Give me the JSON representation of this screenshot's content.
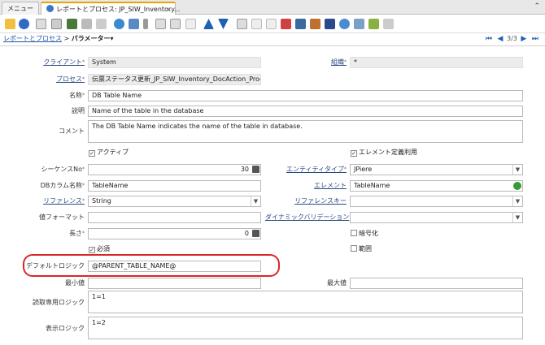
{
  "tabs": {
    "menu": "メニュー",
    "active": "レポートとプロセス: JP_SIW_Inventory...",
    "close": "×",
    "collapse": "⌃"
  },
  "breadcrumb": {
    "parent": "レポートとプロセス",
    "sep": ">",
    "current": "パラメーター▾"
  },
  "nav": {
    "record": "3/3"
  },
  "form": {
    "client_label": "クライアント",
    "client_value": "System",
    "org_label": "組織",
    "org_value": "*",
    "process_label": "プロセス",
    "process_value": "伝票ステータス更新_JP_SIW_Inventory_DocAction_Process",
    "name_label": "名称",
    "name_value": "DB Table Name",
    "desc_label": "説明",
    "desc_value": "Name of the table in the database",
    "comment_label": "コメント",
    "comment_value": "The DB Table Name indicates the name of the table in database.",
    "active_label": "アクティブ",
    "elem_def_label": "エレメント定義利用",
    "seq_label": "シーケンスNo",
    "seq_value": "30",
    "entity_label": "エンティティタイプ",
    "entity_value": "JPiere",
    "dbcol_label": "DBカラム名称",
    "dbcol_value": "TableName",
    "element_label": "エレメント",
    "element_value": "TableName",
    "ref_label": "リファレンス",
    "ref_value": "String",
    "refkey_label": "リファレンスキー",
    "refkey_value": "",
    "fmt_label": "値フォーマット",
    "fmt_value": "",
    "dynval_label": "ダイナミックバリデーション",
    "dynval_value": "",
    "len_label": "長さ",
    "len_value": "0",
    "encrypt_label": "暗号化",
    "mandatory_label": "必須",
    "range_label": "範囲",
    "default_label": "デフォルトロジック",
    "default_value": "@PARENT_TABLE_NAME@",
    "min_label": "最小値",
    "min_value": "",
    "max_label": "最大値",
    "max_value": "",
    "readonly_label": "読取専用ロジック",
    "readonly_value": "1=1",
    "display_label": "表示ロジック",
    "display_value": "1=2"
  },
  "icons": [
    "undo-icon",
    "help-icon",
    "new-icon",
    "copy-icon",
    "delete-icon",
    "save-icon",
    "save-new-icon",
    "refresh-icon",
    "find-icon",
    "attachment-icon",
    "chat-icon",
    "grid-icon",
    "parent-icon",
    "detail-icon",
    "previous-icon",
    "next-icon",
    "report-icon",
    "archive-icon",
    "print-icon",
    "zoom-icon",
    "history-icon",
    "workflow-icon",
    "product-info-icon",
    "settings-icon",
    "export-icon",
    "import-icon",
    "end-icon"
  ],
  "colors": {
    "accent": "#e5a700",
    "link": "#2255aa",
    "highlight": "#d9262b"
  }
}
